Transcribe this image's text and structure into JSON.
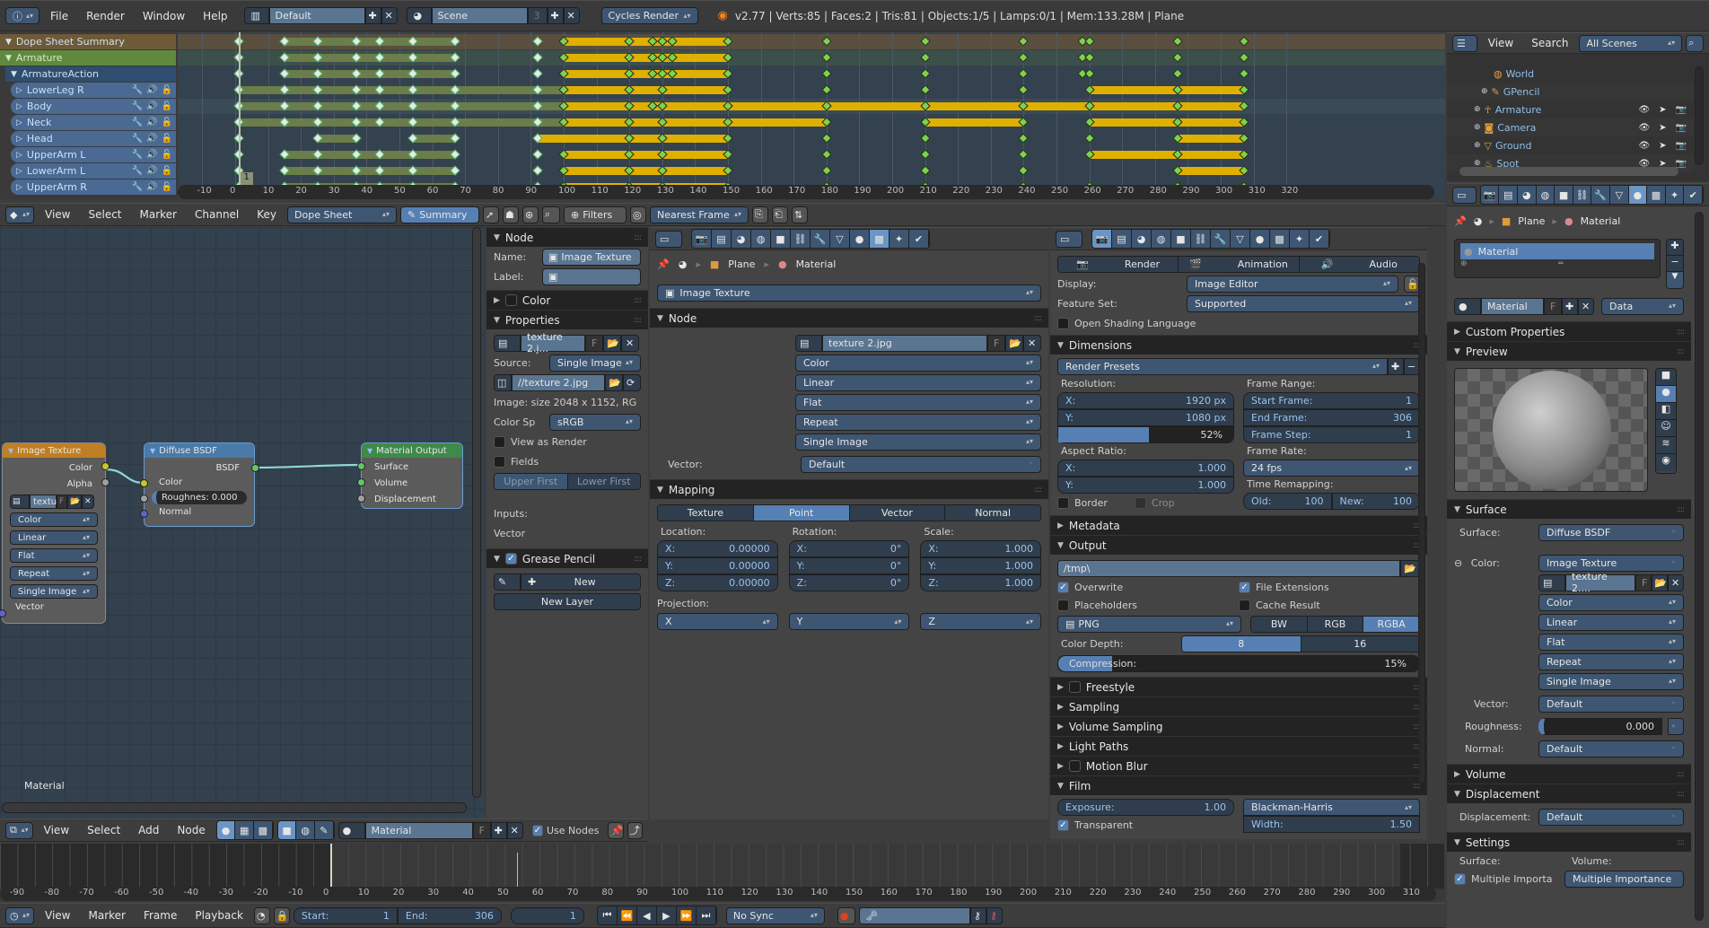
{
  "topbar": {
    "menus": [
      "File",
      "Render",
      "Window",
      "Help"
    ],
    "layout": "Default",
    "scene": "Scene",
    "scene_users": "3",
    "engine": "Cycles Render",
    "stats": "v2.77 | Verts:85 | Faces:2 | Tris:81 | Objects:1/5 | Lamps:0/1 | Mem:133.28M | Plane"
  },
  "dopesheet": {
    "channels": [
      {
        "name": "Dope Sheet Summary",
        "type": "summary"
      },
      {
        "name": "Armature",
        "type": "object"
      },
      {
        "name": "ArmatureAction",
        "type": "action"
      },
      {
        "name": "LowerLeg R",
        "type": "group"
      },
      {
        "name": "Body",
        "type": "group"
      },
      {
        "name": "Neck",
        "type": "group"
      },
      {
        "name": "Head",
        "type": "group"
      },
      {
        "name": "UpperArm L",
        "type": "group"
      },
      {
        "name": "LowerArm L",
        "type": "group"
      },
      {
        "name": "UpperArm R",
        "type": "group"
      }
    ],
    "current_frame": "1",
    "ruler": [
      "-10",
      "0",
      "10",
      "20",
      "30",
      "40",
      "50",
      "60",
      "70",
      "80",
      "90",
      "100",
      "110",
      "120",
      "130",
      "140",
      "150",
      "160",
      "170",
      "180",
      "190",
      "200",
      "210",
      "220",
      "230",
      "240",
      "250",
      "260",
      "270",
      "280",
      "290",
      "300",
      "310",
      "320"
    ],
    "rows": [
      {
        "keys": [
          1,
          15,
          25,
          37,
          44,
          54,
          67,
          92,
          100,
          120,
          127,
          130,
          133,
          150,
          180,
          210,
          240,
          258,
          260,
          287,
          307
        ],
        "holds": [
          [
            15,
            67,
            "green"
          ],
          [
            100,
            150,
            "yellow"
          ]
        ]
      },
      {
        "keys": [
          1,
          15,
          25,
          37,
          44,
          54,
          67,
          92,
          100,
          120,
          127,
          130,
          133,
          150,
          180,
          210,
          240,
          258,
          260,
          287,
          307
        ],
        "holds": [
          [
            15,
            67,
            "green"
          ],
          [
            100,
            150,
            "yellow"
          ]
        ]
      },
      {
        "keys": [
          1,
          15,
          25,
          37,
          44,
          54,
          67,
          92,
          100,
          120,
          127,
          130,
          133,
          150,
          180,
          210,
          240,
          258,
          260,
          287,
          307
        ],
        "holds": [
          [
            15,
            67,
            "green"
          ],
          [
            100,
            150,
            "yellow"
          ]
        ]
      },
      {
        "keys": [
          1,
          15,
          25,
          37,
          44,
          54,
          67,
          92,
          100,
          120,
          130,
          150,
          180,
          210,
          240,
          260,
          287,
          307
        ],
        "holds": [
          [
            1,
            100,
            "green"
          ],
          [
            100,
            150,
            "yellow"
          ],
          [
            260,
            307,
            "yellow"
          ]
        ]
      },
      {
        "keys": [
          1,
          15,
          25,
          37,
          44,
          54,
          67,
          92,
          100,
          120,
          127,
          130,
          150,
          180,
          210,
          240,
          260,
          287,
          307
        ],
        "holds": [
          [
            1,
            100,
            "green"
          ],
          [
            100,
            307,
            "yellow"
          ]
        ]
      },
      {
        "keys": [
          1,
          15,
          25,
          37,
          44,
          54,
          67,
          92,
          100,
          120,
          130,
          150,
          180,
          210,
          240,
          260,
          287,
          307
        ],
        "holds": [
          [
            1,
            100,
            "green"
          ],
          [
            100,
            180,
            "yellow"
          ],
          [
            210,
            240,
            "yellow"
          ],
          [
            260,
            307,
            "yellow"
          ]
        ]
      },
      {
        "keys": [
          1,
          25,
          37,
          54,
          67,
          92,
          120,
          130,
          150,
          180,
          210,
          240,
          260,
          287,
          307
        ],
        "holds": [
          [
            25,
            37,
            "green"
          ],
          [
            54,
            67,
            "green"
          ],
          [
            92,
            150,
            "yellow"
          ],
          [
            287,
            307,
            "yellow"
          ]
        ]
      },
      {
        "keys": [
          1,
          15,
          25,
          37,
          44,
          54,
          67,
          92,
          100,
          120,
          130,
          150,
          180,
          210,
          240,
          260,
          287,
          307
        ],
        "holds": [
          [
            15,
            67,
            "green"
          ],
          [
            100,
            150,
            "yellow"
          ],
          [
            260,
            307,
            "yellow"
          ]
        ]
      },
      {
        "keys": [
          1,
          15,
          25,
          37,
          44,
          54,
          67,
          92,
          100,
          120,
          130,
          150,
          180,
          210,
          240,
          287,
          307
        ],
        "holds": [
          [
            15,
            67,
            "green"
          ],
          [
            100,
            150,
            "yellow"
          ],
          [
            287,
            307,
            "yellow"
          ]
        ]
      },
      {
        "keys": [
          1,
          15,
          25,
          37,
          44,
          54,
          67,
          92,
          100,
          120,
          130,
          150,
          180,
          210,
          240,
          260,
          287,
          307
        ],
        "holds": [
          [
            15,
            67,
            "green"
          ],
          [
            100,
            150,
            "yellow"
          ]
        ]
      }
    ],
    "header": {
      "menus": [
        "View",
        "Select",
        "Marker",
        "Channel",
        "Key"
      ],
      "mode": "Dope Sheet",
      "summary": "Summary",
      "filters": "Filters",
      "snap": "Nearest Frame"
    }
  },
  "outliner": {
    "menus": [
      "View",
      "Search"
    ],
    "filter": "All Scenes",
    "items": [
      {
        "name": "World",
        "icon": "world-icon"
      },
      {
        "name": "GPencil",
        "icon": "pencil-icon"
      },
      {
        "name": "Armature",
        "icon": "armature-icon"
      },
      {
        "name": "Camera",
        "icon": "camera-icon"
      },
      {
        "name": "Ground",
        "icon": "mesh-icon"
      },
      {
        "name": "Spot",
        "icon": "lamp-icon"
      }
    ]
  },
  "node_editor": {
    "nodes": {
      "image_texture": {
        "title": "Image Texture",
        "outputs": [
          "Color",
          "Alpha"
        ],
        "image": "textu",
        "options": [
          "Color",
          "Linear",
          "Flat",
          "Repeat",
          "Single Image"
        ],
        "input": "Vector"
      },
      "diffuse": {
        "title": "Diffuse BSDF",
        "output": "BSDF",
        "inputs": [
          "Color",
          "Normal"
        ],
        "roughness": "Roughnes: 0.000"
      },
      "output": {
        "title": "Material Output",
        "inputs": [
          "Surface",
          "Volume",
          "Displacement"
        ]
      }
    },
    "tree_label": "Material",
    "header": {
      "menus": [
        "View",
        "Select",
        "Add",
        "Node"
      ],
      "material": "Material",
      "use_nodes": "Use Nodes"
    }
  },
  "node_sidebar": {
    "node_panel": "Node",
    "name_label": "Name:",
    "name_value": "Image Texture",
    "label_label": "Label:",
    "color_panel": "Color",
    "properties_panel": "Properties",
    "image": "texture 2.j...",
    "source_label": "Source:",
    "source": "Single Image",
    "filepath": "//texture 2.jpg",
    "image_info": "Image: size 2048 x 1152, RG",
    "colorspace_label": "Color Sp",
    "colorspace": "sRGB",
    "view_as_render": "View as Render",
    "fields": "Fields",
    "upper_first": "Upper First",
    "lower_first": "Lower First",
    "inputs_label": "Inputs:",
    "vector_label": "Vector",
    "grease_pencil_panel": "Grease Pencil",
    "new": "New",
    "new_layer": "New Layer"
  },
  "texture_props": {
    "breadcrumb": [
      "Plane",
      "Material"
    ],
    "texture_type": "Image Texture",
    "node_panel": "Node",
    "image": "texture 2.jpg",
    "options": [
      "Color",
      "Linear",
      "Flat",
      "Repeat",
      "Single Image"
    ],
    "vector_label": "Vector:",
    "vector": "Default",
    "mapping_panel": "Mapping",
    "mapping_tabs": [
      "Texture",
      "Point",
      "Vector",
      "Normal"
    ],
    "mapping_selected": "Point",
    "location_label": "Location:",
    "rotation_label": "Rotation:",
    "scale_label": "Scale:",
    "location": [
      [
        "X:",
        "0.00000"
      ],
      [
        "Y:",
        "0.00000"
      ],
      [
        "Z:",
        "0.00000"
      ]
    ],
    "rotation": [
      [
        "X:",
        "0°"
      ],
      [
        "Y:",
        "0°"
      ],
      [
        "Z:",
        "0°"
      ]
    ],
    "scale": [
      [
        "X:",
        "1.000"
      ],
      [
        "Y:",
        "1.000"
      ],
      [
        "Z:",
        "1.000"
      ]
    ],
    "projection_label": "Projection:",
    "projection": [
      "X",
      "Y",
      "Z"
    ]
  },
  "render_props": {
    "tabs": [
      "Render",
      "Animation",
      "Audio"
    ],
    "display_label": "Display:",
    "display": "Image Editor",
    "feature_label": "Feature Set:",
    "feature": "Supported",
    "osl": "Open Shading Language",
    "dimensions_panel": "Dimensions",
    "presets": "Render Presets",
    "resolution_label": "Resolution:",
    "res_x": [
      "X:",
      "1920 px"
    ],
    "res_y": [
      "Y:",
      "1080 px"
    ],
    "res_percent": "52%",
    "res_percent_value": 0.52,
    "aspect_label": "Aspect Ratio:",
    "aspect_x": [
      "X:",
      "1.000"
    ],
    "aspect_y": [
      "Y:",
      "1.000"
    ],
    "border": "Border",
    "crop": "Crop",
    "frame_range_label": "Frame Range:",
    "start": [
      "Start Frame:",
      "1"
    ],
    "end": [
      "End Frame:",
      "306"
    ],
    "step": [
      "Frame Step:",
      "1"
    ],
    "frame_rate_label": "Frame Rate:",
    "frame_rate": "24 fps",
    "remap_label": "Time Remapping:",
    "old": [
      "Old:",
      "100"
    ],
    "new": [
      "New:",
      "100"
    ],
    "metadata_panel": "Metadata",
    "output_panel": "Output",
    "output_path": "/tmp\\",
    "overwrite": "Overwrite",
    "file_ext": "File Extensions",
    "placeholders": "Placeholders",
    "cache": "Cache Result",
    "format": "PNG",
    "color_modes": [
      "BW",
      "RGB",
      "RGBA"
    ],
    "color_mode_selected": "RGBA",
    "depth_label": "Color Depth:",
    "depths": [
      "8",
      "16"
    ],
    "depth_selected": "8",
    "compression_label": "Compression:",
    "compression": "15%",
    "compression_value": 0.15,
    "collapsed_panels": [
      "Freestyle",
      "Sampling",
      "Volume Sampling",
      "Light Paths",
      "Motion Blur"
    ],
    "film_panel": "Film",
    "exposure": [
      "Exposure:",
      "1.00"
    ],
    "filter": "Blackman-Harris",
    "transparent": "Transparent",
    "width": [
      "Width:",
      "1.50"
    ]
  },
  "material_props": {
    "breadcrumb": [
      "Plane",
      "Material"
    ],
    "slot": "Material",
    "material": "Material",
    "link": "Data",
    "custom_props_panel": "Custom Properties",
    "preview_panel": "Preview",
    "surface_panel": "Surface",
    "surface_label": "Surface:",
    "surface": "Diffuse BSDF",
    "color_label": "Color:",
    "color": "Image Texture",
    "image": "texture 2....",
    "options": [
      "Color",
      "Linear",
      "Flat",
      "Repeat",
      "Single Image"
    ],
    "vector_label": "Vector:",
    "vector": "Default",
    "roughness_label": "Roughness:",
    "roughness": "0.000",
    "normal_label": "Normal:",
    "normal": "Default",
    "volume_panel": "Volume",
    "displacement_panel": "Displacement",
    "displacement_label": "Displacement:",
    "displacement": "Default",
    "settings_panel": "Settings",
    "settings_surface": "Surface:",
    "settings_volume": "Volume:",
    "mis": "Multiple Importa",
    "mis_vol": "Multiple Importance"
  },
  "timeline": {
    "ruler": [
      "-90",
      "-80",
      "-70",
      "-60",
      "-50",
      "-40",
      "-30",
      "-20",
      "-10",
      "0",
      "10",
      "20",
      "30",
      "40",
      "50",
      "60",
      "70",
      "80",
      "90",
      "100",
      "110",
      "120",
      "130",
      "140",
      "150",
      "160",
      "170",
      "180",
      "190",
      "200",
      "210",
      "220",
      "230",
      "240",
      "250",
      "260",
      "270",
      "280",
      "290",
      "300",
      "310"
    ],
    "menus": [
      "View",
      "Marker",
      "Frame",
      "Playback"
    ],
    "start": [
      "Start:",
      "1"
    ],
    "end": [
      "End:",
      "306"
    ],
    "current": "1",
    "sync": "No Sync"
  }
}
